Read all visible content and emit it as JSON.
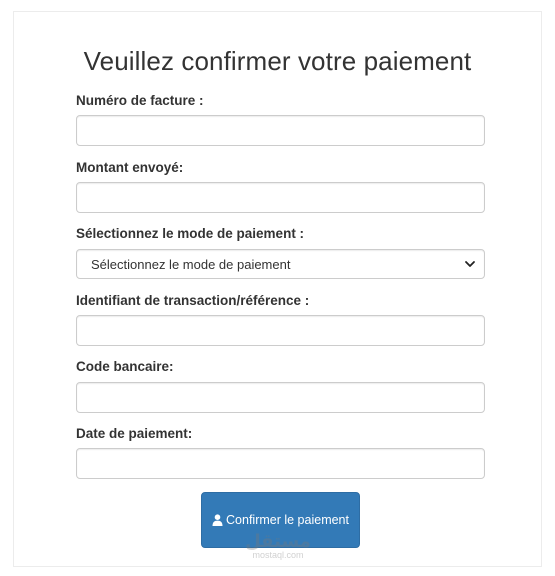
{
  "form": {
    "title": "Veuillez confirmer votre paiement",
    "fields": [
      {
        "label": "Numéro de facture :",
        "value": "",
        "placeholder": ""
      },
      {
        "label": "Montant envoyé:",
        "value": "",
        "placeholder": ""
      },
      {
        "label": "Sélectionnez le mode de paiement :",
        "selected": "Sélectionnez le mode de paiement"
      },
      {
        "label": "Identifiant de transaction/référence :",
        "value": "",
        "placeholder": ""
      },
      {
        "label": "Code bancaire:",
        "value": "",
        "placeholder": ""
      },
      {
        "label": "Date de paiement:",
        "value": "",
        "placeholder": ""
      }
    ],
    "submit_label": "Confirmer le paiement",
    "submit_icon": "user-icon",
    "chevron_icon": "chevron-down-icon"
  },
  "colors": {
    "primary": "#337ab7",
    "primary_border": "#2e6da4",
    "input_border": "#cccccc",
    "text": "#333333"
  },
  "watermark": {
    "arabic": "مستقل",
    "latin": "mostaql.com"
  }
}
